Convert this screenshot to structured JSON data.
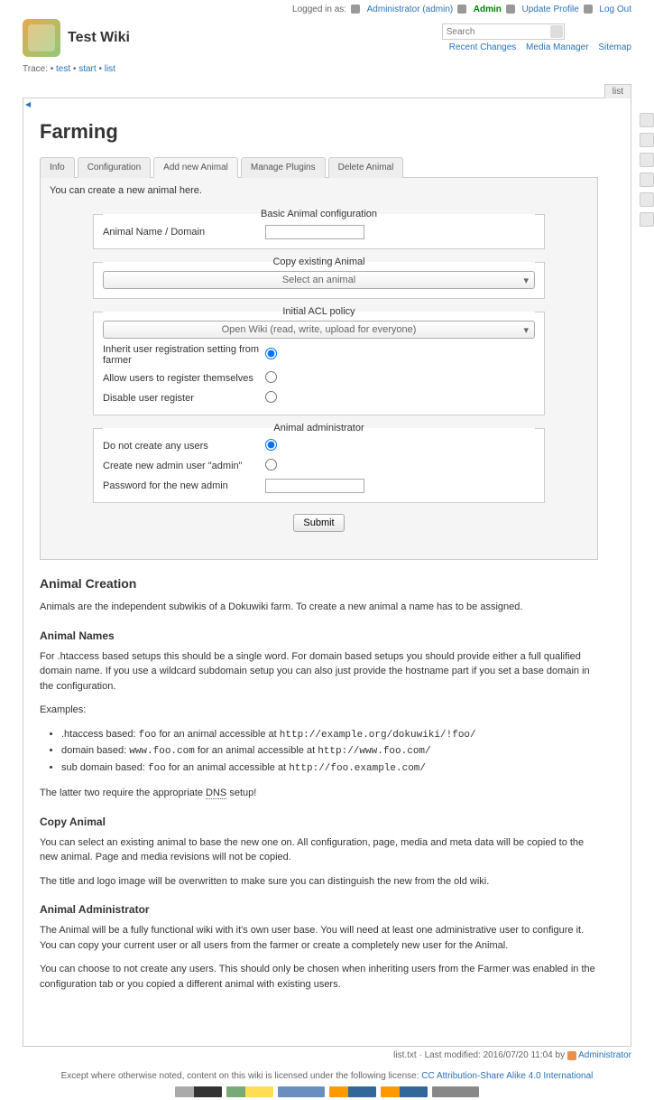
{
  "topbar": {
    "logged_in_as": "Logged in as:",
    "user_link": "Administrator (admin)",
    "admin": "Admin",
    "update_profile": "Update Profile",
    "logout": "Log Out"
  },
  "site_title": "Test Wiki",
  "search": {
    "placeholder": "Search"
  },
  "nav": {
    "recent_changes": "Recent Changes",
    "media_manager": "Media Manager",
    "sitemap": "Sitemap"
  },
  "trace": {
    "label": "Trace:",
    "test": "test",
    "start": "start",
    "list": "list"
  },
  "panel_tab": "list",
  "page": {
    "title": "Farming",
    "tabs": [
      "Info",
      "Configuration",
      "Add new Animal",
      "Manage Plugins",
      "Delete Animal"
    ],
    "intro": "You can create a new animal here.",
    "fieldsets": {
      "basic": {
        "legend": "Basic Animal configuration",
        "name_label": "Animal Name / Domain"
      },
      "copy": {
        "legend": "Copy existing Animal",
        "select": "Select an animal"
      },
      "acl": {
        "legend": "Initial ACL policy",
        "select": "Open Wiki (read, write, upload for everyone)",
        "inherit": "Inherit user registration setting from farmer",
        "allow": "Allow users to register themselves",
        "disable": "Disable user register"
      },
      "admin": {
        "legend": "Animal administrator",
        "no_create": "Do not create any users",
        "create_admin": "Create new admin user \"admin\"",
        "password": "Password for the new admin"
      }
    },
    "submit": "Submit",
    "doc": {
      "h2": "Animal Creation",
      "p1": "Animals are the independent subwikis of a Dokuwiki farm. To create a new animal a name has to be assigned.",
      "h3a": "Animal Names",
      "p2": "For .htaccess based setups this should be a single word. For domain based setups you should provide either a full qualified domain name. If you use a wildcard subdomain setup you can also just provide the hostname part if you set a base domain in the configuration.",
      "examples": "Examples:",
      "li1a": ".htaccess based: ",
      "li1b": "foo",
      "li1c": " for an animal accessible at ",
      "li1d": "http://example.org/dokuwiki/!foo/",
      "li2a": "domain based: ",
      "li2b": "www.foo.com",
      "li2c": " for an animal accessible at ",
      "li2d": "http://www.foo.com/",
      "li3a": "sub domain based: ",
      "li3b": "foo",
      "li3c": " for an animal accessible at ",
      "li3d": "http://foo.example.com/",
      "p3a": "The latter two require the appropriate ",
      "p3b": "DNS",
      "p3c": " setup!",
      "h3b": "Copy Animal",
      "p4": "You can select an existing animal to base the new one on. All configuration, page, media and meta data will be copied to the new animal. Page and media revisions will not be copied.",
      "p5": "The title and logo image will be overwritten to make sure you can distinguish the new from the old wiki.",
      "h3c": "Animal Administrator",
      "p6": "The Animal will be a fully functional wiki with it's own user base. You will need at least one administrative user to configure it. You can copy your current user or all users from the farmer or create a completely new user for the Animal.",
      "p7": "You can choose to not create any users. This should only be chosen when inheriting users from the Farmer was enabled in the configuration tab or you copied a different animal with existing users."
    }
  },
  "footer": {
    "meta": "list.txt · Last modified: 2016/07/20 11:04 by ",
    "meta_user": "Administrator",
    "license": "Except where otherwise noted, content on this wiki is licensed under the following license: ",
    "license_link": "CC Attribution-Share Alike 4.0 International"
  }
}
